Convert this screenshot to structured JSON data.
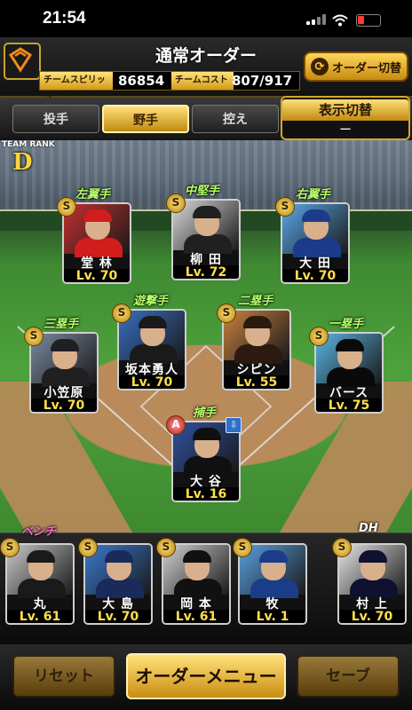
{
  "status_bar": {
    "time": "21:54"
  },
  "header": {
    "title": "通常オーダー",
    "spirits_label": "チームスピリッツ",
    "spirits_value": "86854",
    "cost_label": "チームコスト",
    "cost_value": "807/917",
    "order_switch_label": "オーダー切替"
  },
  "tabs": [
    {
      "label": "投手",
      "active": false
    },
    {
      "label": "野手",
      "active": true
    },
    {
      "label": "控え",
      "active": false
    }
  ],
  "display_switch": {
    "label": "表示切替",
    "value": "ー"
  },
  "team_rank": {
    "label": "TEAM RANK",
    "value": "D"
  },
  "lineup": [
    {
      "position": "左翼手",
      "name": "堂 林",
      "level": "Lv. 70",
      "photo": "#c43030",
      "cap": "#d21d1d",
      "badge": "S"
    },
    {
      "position": "中堅手",
      "name": "柳 田",
      "level": "Lv. 72",
      "photo": "#d9d9d9",
      "cap": "#202020",
      "badge": "S"
    },
    {
      "position": "右翼手",
      "name": "大 田",
      "level": "Lv. 70",
      "photo": "#5aa6e6",
      "cap": "#1a3c8a",
      "badge": "S"
    },
    {
      "position": "遊撃手",
      "name": "坂本勇人",
      "level": "Lv. 70",
      "photo": "#3a6fc4",
      "cap": "#1a1a1a",
      "badge": "S"
    },
    {
      "position": "二塁手",
      "name": "シピン",
      "level": "Lv. 55",
      "photo": "#c98040",
      "cap": "#2a1a10",
      "badge": "S"
    },
    {
      "position": "三塁手",
      "name": "小笠原",
      "level": "Lv. 70",
      "photo": "#7a8aa0",
      "cap": "#202020",
      "badge": "S"
    },
    {
      "position": "一塁手",
      "name": "バース",
      "level": "Lv. 75",
      "photo": "#5ab4e0",
      "cap": "#0a0a0a",
      "badge": "S"
    },
    {
      "position": "捕手",
      "name": "大 谷",
      "level": "Lv. 16",
      "photo": "#3050a0",
      "cap": "#101010",
      "badge": "A"
    }
  ],
  "bench": {
    "label": "ベンチ"
  },
  "dh": {
    "label": "DH"
  },
  "bench_players": [
    {
      "name": "丸",
      "level": "Lv. 61",
      "photo": "#c8c8c8",
      "cap": "#1a1a1a",
      "badge": "S"
    },
    {
      "name": "大 島",
      "level": "Lv. 70",
      "photo": "#3a7ad0",
      "cap": "#1a2a5a",
      "badge": "S"
    },
    {
      "name": "岡 本",
      "level": "Lv. 61",
      "photo": "#d0d0d0",
      "cap": "#111111",
      "badge": "S"
    },
    {
      "name": "牧",
      "level": "Lv. 1",
      "photo": "#5aa0e0",
      "cap": "#1a3c8a",
      "badge": "S"
    },
    {
      "name": "村 上",
      "level": "Lv. 70",
      "photo": "#e6e6e6",
      "cap": "#101030",
      "badge": "S"
    }
  ],
  "footer": {
    "reset_label": "リセット",
    "order_menu_label": "オーダーメニュー",
    "save_label": "セーブ"
  }
}
